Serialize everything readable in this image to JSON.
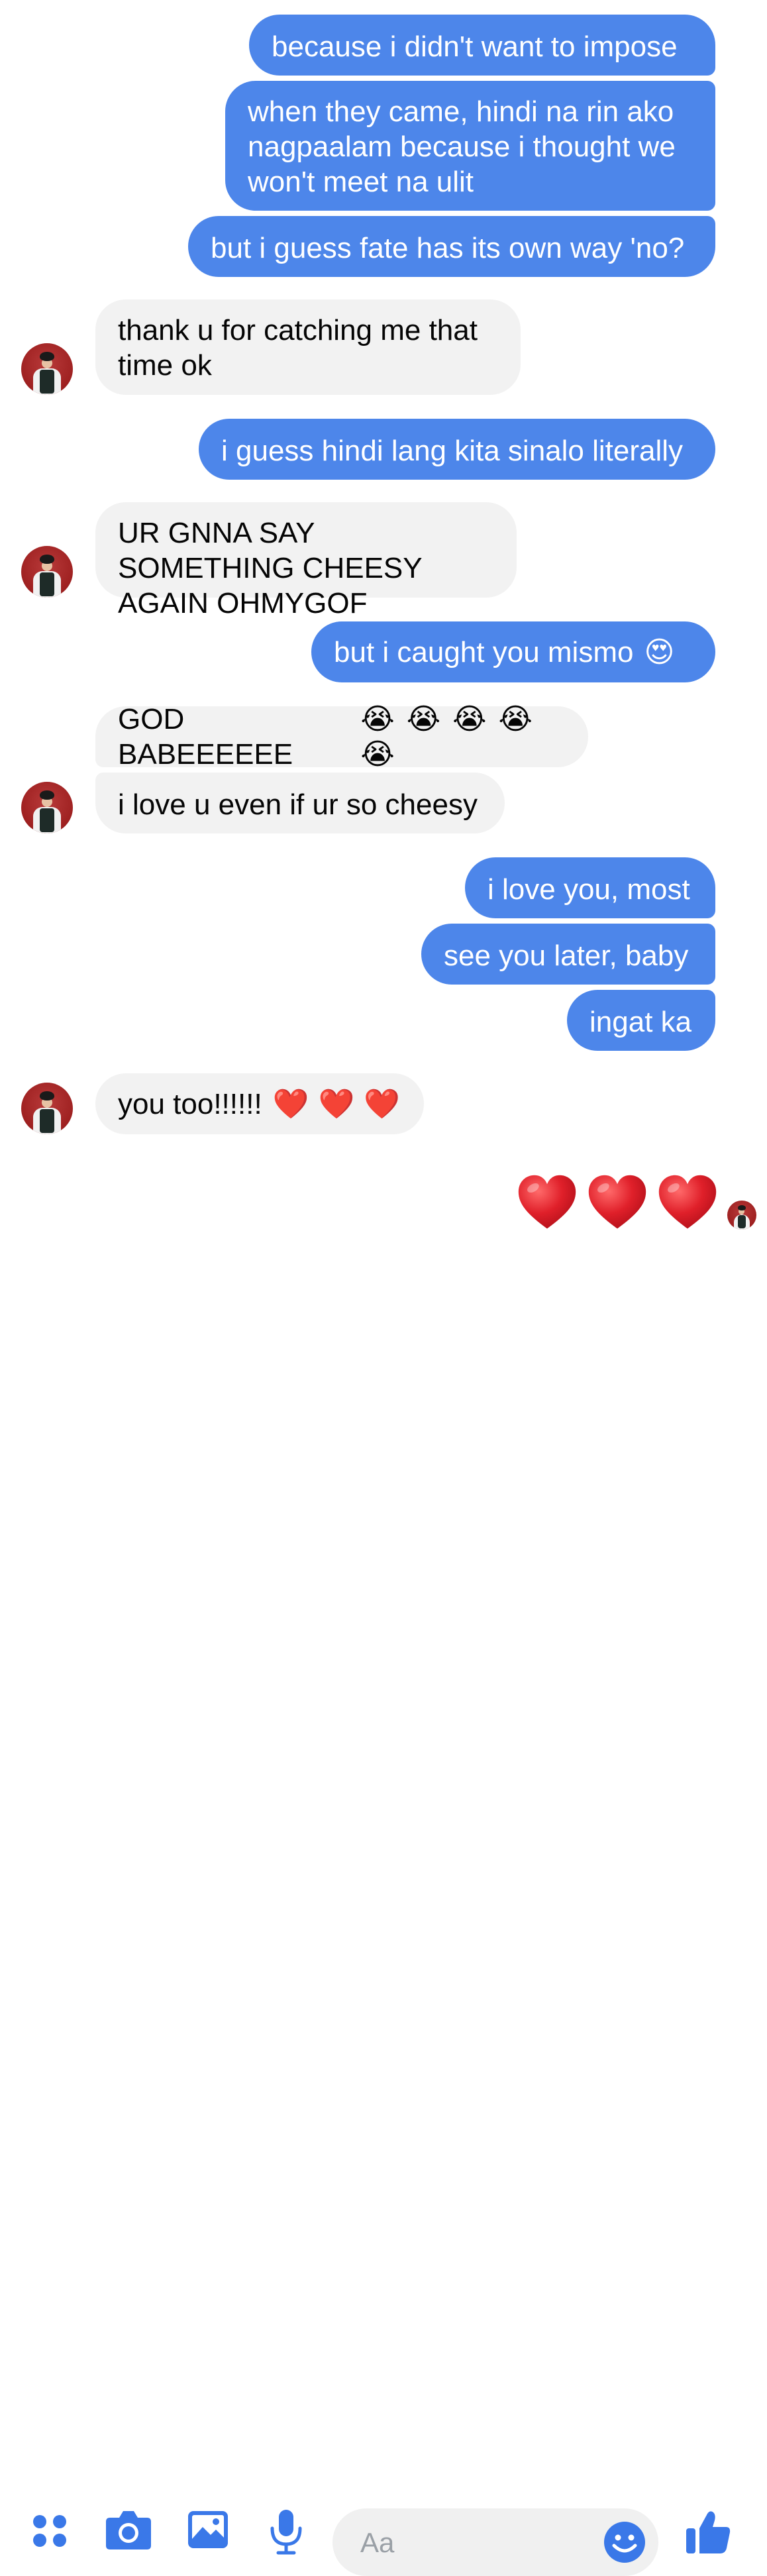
{
  "messages": [
    {
      "side": "sent",
      "text": "because i didn't want to impose"
    },
    {
      "side": "sent",
      "text": "when they came, hindi na rin ako nagpaalam because i thought we won't meet na ulit"
    },
    {
      "side": "sent",
      "text": "but i guess fate has its own way 'no?"
    },
    {
      "side": "recv",
      "text": "thank u for catching me that time ok"
    },
    {
      "side": "sent",
      "text": "i guess hindi lang kita sinalo literally"
    },
    {
      "side": "recv",
      "text": "UR GNNA SAY SOMETHING CHEESY AGAIN OHMYGOF"
    },
    {
      "side": "sent",
      "text": "but i caught you mismo",
      "emoji": "😍"
    },
    {
      "side": "recv",
      "text": "GOD BABEEEEEE",
      "emoji": "😭 😭 😭 😭 😭"
    },
    {
      "side": "recv",
      "text": "i love u even if ur so cheesy"
    },
    {
      "side": "sent",
      "text": "i love you, most"
    },
    {
      "side": "sent",
      "text": "see you later, baby"
    },
    {
      "side": "sent",
      "text": "ingat ka"
    },
    {
      "side": "recv",
      "text": "you too!!!!!!",
      "emoji": "❤️ ❤️ ❤️"
    }
  ],
  "reaction": {
    "hearts": 3
  },
  "composer": {
    "placeholder": "Aa",
    "icons": [
      "apps-icon",
      "camera-icon",
      "gallery-icon",
      "microphone-icon",
      "emoji-icon",
      "thumbs-up-icon"
    ]
  },
  "colors": {
    "sent_bubble": "#4d86ea",
    "recv_bubble": "#f2f2f2",
    "accent": "#3a78e8",
    "heart": "#e0202a"
  }
}
